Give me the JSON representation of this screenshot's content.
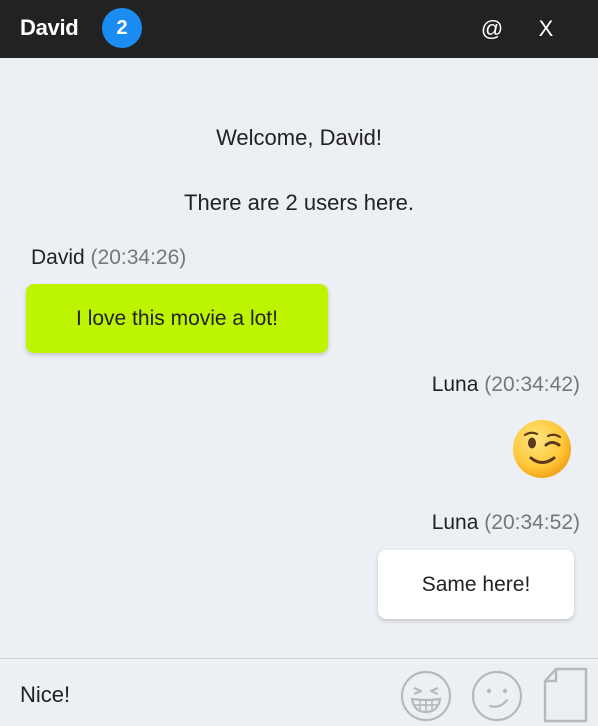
{
  "header": {
    "user_name": "David",
    "user_count_badge": "2",
    "mention_label": "@",
    "close_label": "X"
  },
  "messages": {
    "system": [
      "Welcome, David!",
      "There are 2 users here."
    ],
    "items": [
      {
        "author": "David",
        "time": "(20:34:26)",
        "text": "I love this movie a lot!",
        "side": "left",
        "bubble_color": "#bdf400"
      },
      {
        "author": "Luna",
        "time": "(20:34:42)",
        "emoji": "winking-face",
        "side": "right"
      },
      {
        "author": "Luna",
        "time": "(20:34:52)",
        "text": "Same here!",
        "side": "right",
        "bubble_color": "#ffffff"
      }
    ]
  },
  "composer": {
    "input_value": "Nice!",
    "tools": [
      "grinning-squint-face-icon",
      "smiley-face-icon",
      "file-icon"
    ]
  },
  "colors": {
    "header_bg": "#222222",
    "badge_bg": "#1b8df2",
    "chat_bg": "#eceff3",
    "my_bubble": "#bdf400",
    "other_bubble": "#ffffff"
  }
}
